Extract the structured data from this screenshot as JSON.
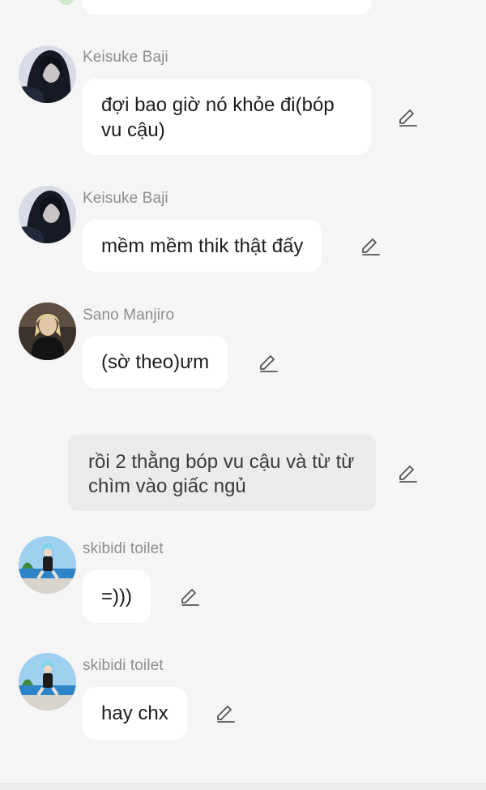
{
  "messages": [
    {
      "author": "Keisuke Baji",
      "text": "đợi bao giờ nó khỏe đi(bóp vu cậu)"
    },
    {
      "author": "Keisuke Baji",
      "text": "mềm mềm thik thật đấy"
    },
    {
      "author": "Sano Manjiro",
      "text": "(sờ theo)ưm"
    },
    {
      "author": "skibidi toilet",
      "text": "=)))"
    },
    {
      "author": "skibidi toilet",
      "text": "hay chx"
    }
  ],
  "narration": {
    "text": "rồi 2 thằng bóp vu cậu và từ từ chìm vào giấc ngủ"
  },
  "icons": {
    "edit": "pencil-edit-icon",
    "avatar_baji": "avatar-keisuke-baji",
    "avatar_manjiro": "avatar-sano-manjiro",
    "avatar_skibidi": "avatar-skibidi-toilet"
  },
  "colors": {
    "background": "#f5f5f5",
    "bubble": "#ffffff",
    "narration_bubble": "#ebebeb",
    "author_name": "#8e8e8e",
    "message_text": "#1c1c1c"
  }
}
